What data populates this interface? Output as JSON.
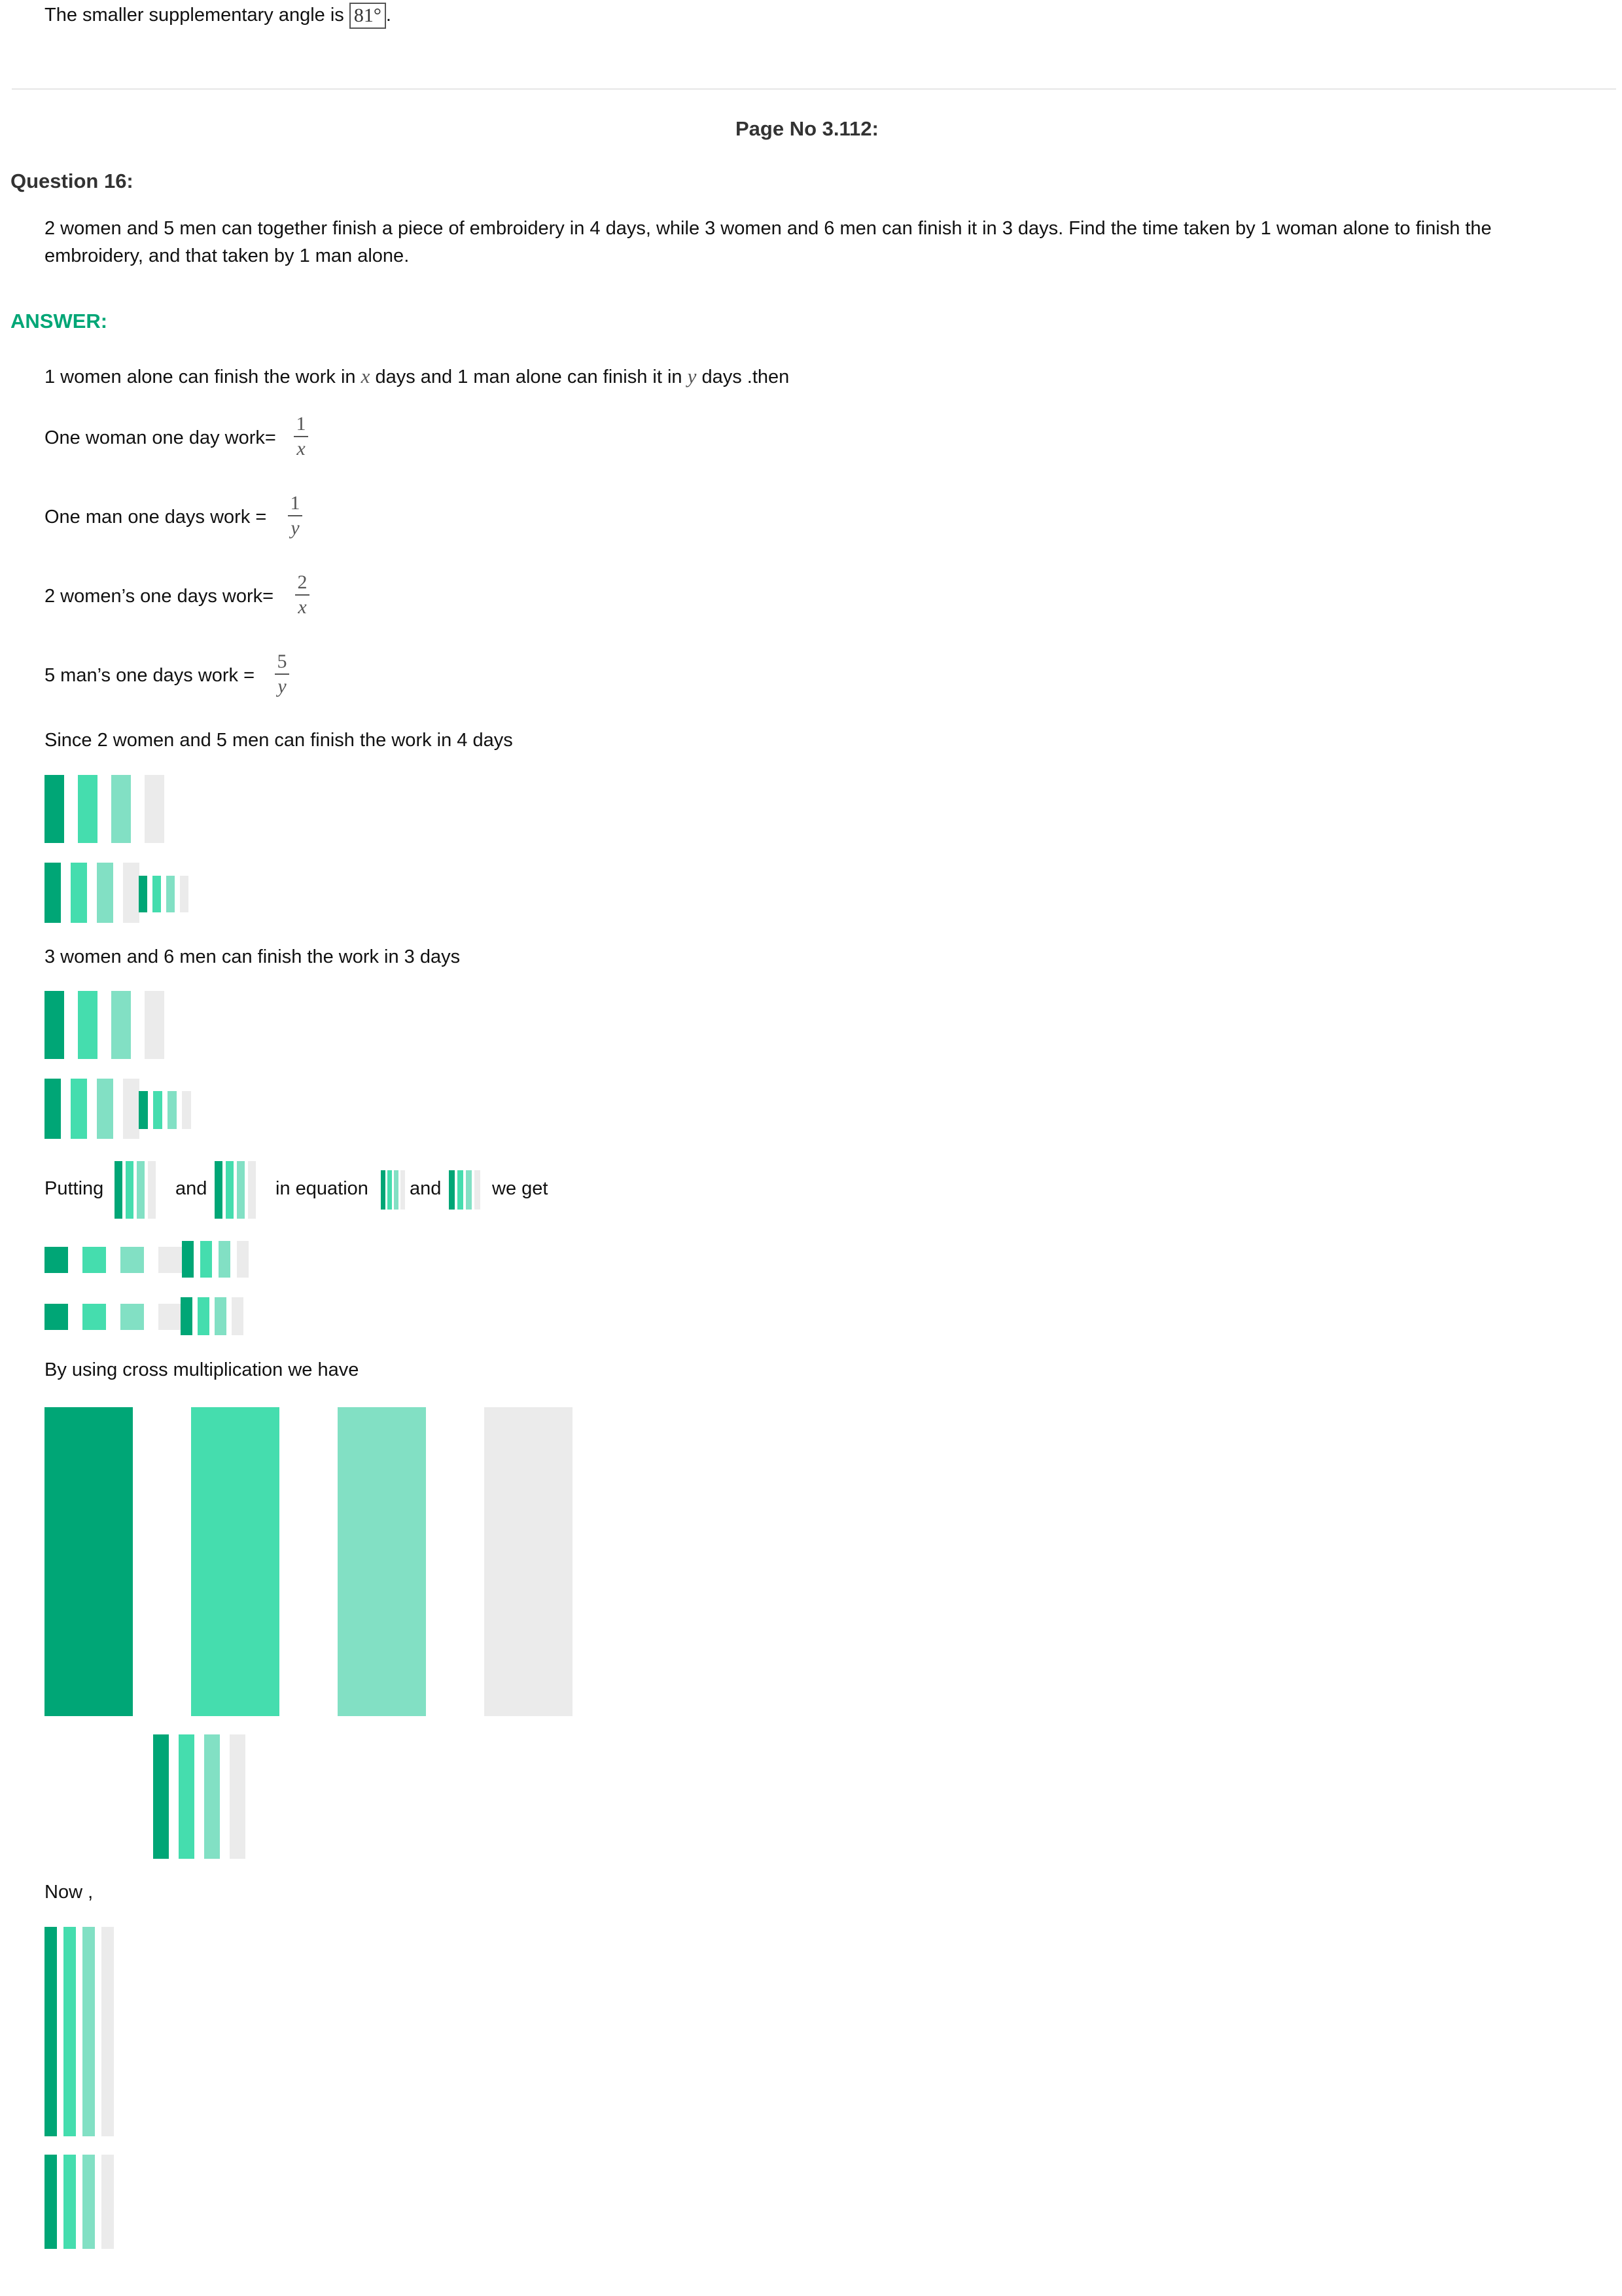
{
  "prev_answer": {
    "text": "The smaller supplementary angle is",
    "boxed_value": "81°",
    "end": "."
  },
  "page_heading": "Page No 3.112:",
  "question_label": "Question 16:",
  "question_text": {
    "line1": "2 women and 5 men can together finish a piece of embroidery in 4 days, while 3 women and 6 men can finish it in 3 days. Find the time taken by 1 woman alone to finish the",
    "line2": "embroidery, and that taken by 1 man alone."
  },
  "answer_label": "ANSWER:",
  "steps": {
    "intro": {
      "part1": "1 women alone can finish the work in",
      "var_x": "x",
      "part2": "days and 1 man alone can finish it in",
      "var_y": "y",
      "part3": "days .then"
    },
    "woman_one_day": {
      "label": "One woman one day work=",
      "num": "1",
      "den": "x"
    },
    "man_one_day": {
      "label": "One man one days work =",
      "num": "1",
      "den": "y"
    },
    "two_women": {
      "label": "2 women’s one days work=",
      "num": "2",
      "den": "x"
    },
    "five_men": {
      "label": "5 man’s one days work =",
      "num": "5",
      "den": "y"
    },
    "since_first": "Since 2 women and 5 men can finish the work in 4 days",
    "since_second": "3 women and 6 men can finish the work in 3 days",
    "putting": {
      "word": "Putting",
      "and1": "and",
      "in_equation": "in equation",
      "and2": "and",
      "we_get": "we get"
    },
    "cross_mult": "By using cross multiplication we have",
    "now": "Now ,"
  },
  "colors": {
    "accent": "#00a676",
    "equation_placeholder_palette": [
      "#00a676",
      "#45ddae",
      "#82e0c4",
      "#ebebeb"
    ]
  }
}
